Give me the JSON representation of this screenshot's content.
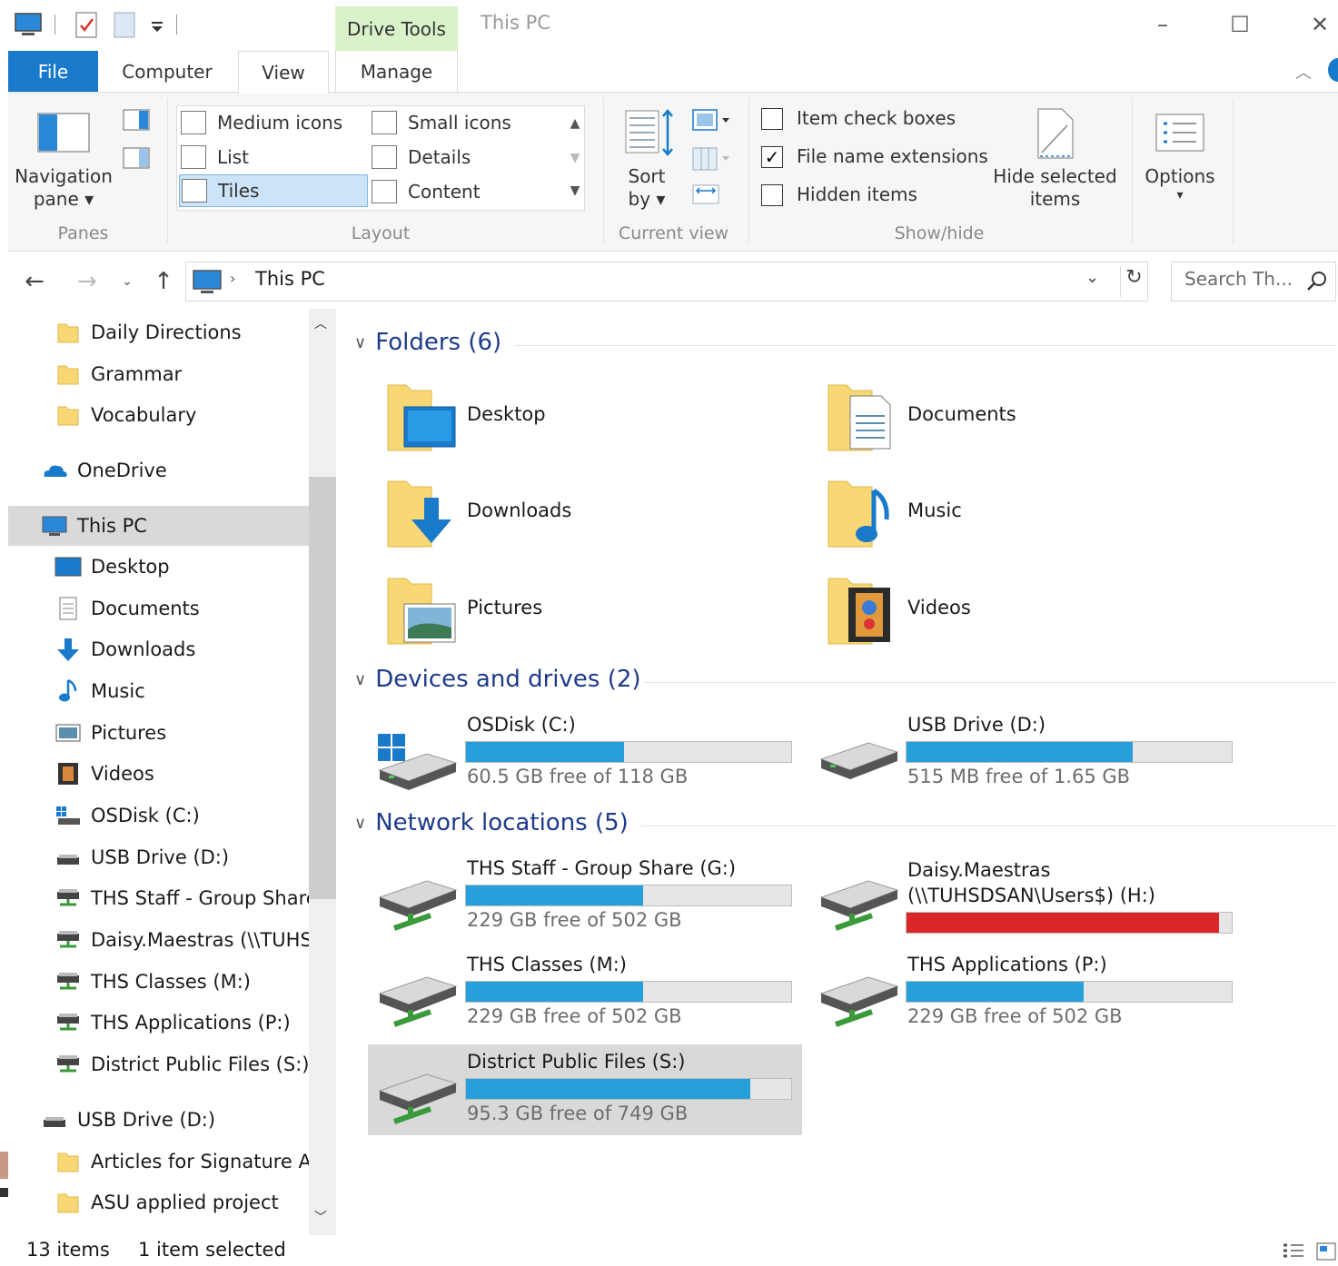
{
  "window": {
    "title": "This PC",
    "context_tab": "Drive Tools",
    "minimize": "–",
    "maximize": "☐",
    "close": "✕"
  },
  "tabs": {
    "file": "File",
    "computer": "Computer",
    "view": "View",
    "manage": "Manage"
  },
  "ribbon": {
    "panes": {
      "label": "Panes",
      "navigation_pane": "Navigation",
      "navigation_pane_2": "pane ▾"
    },
    "layout": {
      "label": "Layout",
      "items": [
        "Medium icons",
        "Small icons",
        "List",
        "Details",
        "Tiles",
        "Content"
      ],
      "selected": "Tiles"
    },
    "current_view": {
      "label": "Current view",
      "sort_by": "Sort",
      "sort_by_2": "by ▾"
    },
    "show_hide": {
      "label": "Show/hide",
      "item_check_boxes": "Item check boxes",
      "file_name_extensions": "File name extensions",
      "hidden_items": "Hidden items",
      "hide_selected": "Hide selected",
      "hide_selected_2": "items",
      "file_name_extensions_checked": true,
      "item_check_boxes_checked": false,
      "hidden_items_checked": false
    },
    "options": {
      "label": "Options",
      "arrow": "▾"
    }
  },
  "address": {
    "path": "This PC",
    "search_placeholder": "Search Th..."
  },
  "nav": {
    "items": [
      "Daily Directions",
      "Grammar",
      "Vocabulary",
      "OneDrive",
      "This PC",
      "Desktop",
      "Documents",
      "Downloads",
      "Music",
      "Pictures",
      "Videos",
      "OSDisk (C:)",
      "USB Drive (D:)",
      "THS Staff - Group Share",
      "Daisy.Maestras (\\\\TUHS",
      "THS Classes (M:)",
      "THS Applications (P:)",
      "District Public Files (S:)",
      "USB Drive (D:)",
      "Articles for Signature As",
      "ASU applied project"
    ]
  },
  "content": {
    "folders_title": "Folders (6)",
    "folders": [
      "Desktop",
      "Documents",
      "Downloads",
      "Music",
      "Pictures",
      "Videos"
    ],
    "devices_title": "Devices and drives (2)",
    "devices": [
      {
        "name": "OSDisk (C:)",
        "free": "60.5 GB free of 118 GB",
        "used_fraction": 0.487
      },
      {
        "name": "USB Drive (D:)",
        "free": "515 MB free of 1.65 GB",
        "used_fraction": 0.695
      }
    ],
    "network_title": "Network locations (5)",
    "network": [
      {
        "name": "THS Staff - Group Share (G:)",
        "free": "229 GB free of 502 GB",
        "used_fraction": 0.544
      },
      {
        "name": "Daisy.Maestras",
        "name2": "(\\\\TUHSDSAN\\Users$) (H:)",
        "free": "",
        "used_fraction": 0.96,
        "critical": true
      },
      {
        "name": "THS Classes (M:)",
        "free": "229 GB free of 502 GB",
        "used_fraction": 0.544
      },
      {
        "name": "THS Applications (P:)",
        "free": "229 GB free of 502 GB",
        "used_fraction": 0.544
      },
      {
        "name": "District Public Files (S:)",
        "free": "95.3 GB free of 749 GB",
        "used_fraction": 0.873
      }
    ]
  },
  "status": {
    "items": "13 items",
    "selected": "1 item selected"
  },
  "colors": {
    "accent": "#1979ca",
    "bar": "#26a0da",
    "bar_critical": "#da2626",
    "context_tab": "#d9f2c9"
  }
}
